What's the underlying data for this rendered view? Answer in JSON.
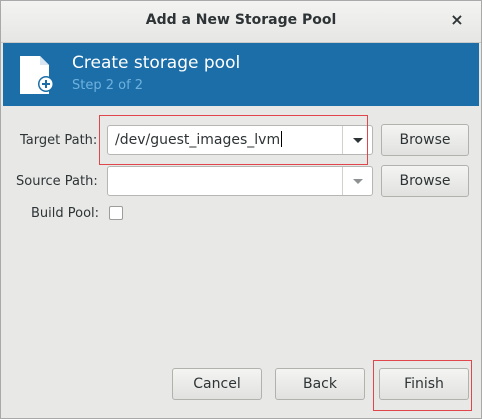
{
  "dialog": {
    "title": "Add a New Storage Pool",
    "close_glyph": "×"
  },
  "banner": {
    "title": "Create storage pool",
    "subtitle": "Step 2 of 2",
    "icon": "new-storage-pool-icon",
    "bg_color": "#1b6ea7"
  },
  "form": {
    "target_path": {
      "label": "Target Path:",
      "value": "/dev/guest_images_lvm",
      "browse_label": "Browse"
    },
    "source_path": {
      "label": "Source Path:",
      "value": "",
      "browse_label": "Browse"
    },
    "build_pool": {
      "label": "Build Pool:",
      "checked": false
    }
  },
  "footer": {
    "cancel_label": "Cancel",
    "back_label": "Back",
    "finish_label": "Finish"
  },
  "annotations": {
    "highlight_color": "#e0474c"
  }
}
